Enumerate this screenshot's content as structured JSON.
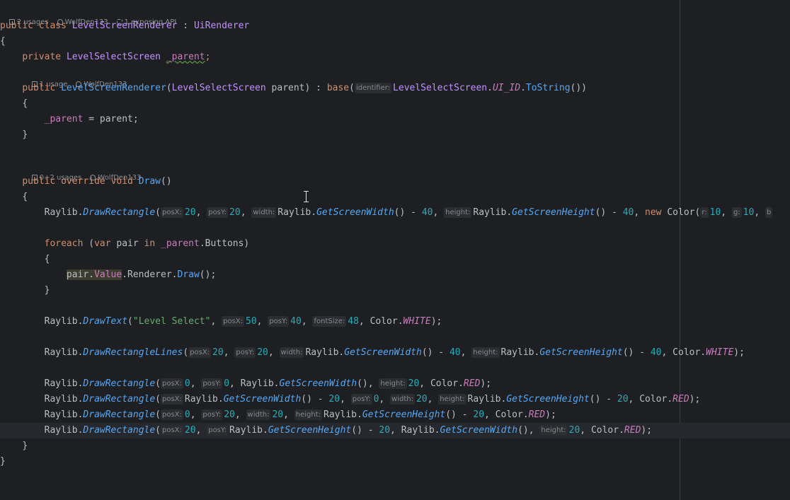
{
  "class_meta": {
    "usages": "2 usages",
    "author": "WolfDen133",
    "api": "1 exposing API"
  },
  "ctor_meta": {
    "usages": "1 usage",
    "author": "WolfDen133"
  },
  "draw_meta": {
    "usages": "0+2 usages",
    "author": "WolfDen133"
  },
  "code": {
    "l1": {
      "kw1": "public",
      "kw2": "class",
      "name": "LevelScreenRenderer",
      "sep": " : ",
      "base": "UiRenderer"
    },
    "l2": "{",
    "l3": {
      "kw": "private",
      "type": "LevelSelectScreen",
      "field": "_parent",
      "semi": ";"
    },
    "l4": {
      "kw": "public",
      "name": "LevelScreenRenderer",
      "open": "(",
      "ptype": "LevelSelectScreen",
      "pname": " parent",
      "close": ") : ",
      "base": "base",
      "bopen": "(",
      "hint": "identifier:",
      "cls": "LevelSelectScreen",
      "dot": ".",
      "const": "UI_ID",
      "dot2": ".",
      "mtd": "ToString",
      "end": "())"
    },
    "l5": "{",
    "l6": {
      "field": "_parent",
      "rest": " = parent;"
    },
    "l7": "}",
    "l8": {
      "kw1": "public",
      "kw2": "override",
      "kw3": "void",
      "name": "Draw",
      "rest": "()"
    },
    "l9": "{",
    "l10": {
      "a": "Raylib.",
      "m": "DrawRectangle",
      "p": "(",
      "h1": "posX:",
      "n1": "20",
      "c1": ", ",
      "h2": "posY:",
      "n2": "20",
      "c2": ", ",
      "h3": "width:",
      "t3": "Raylib.",
      "m3": "GetScreenWidth",
      "r3": "() - ",
      "n3": "40",
      "c3": ", ",
      "h4": "height:",
      "t4": "Raylib.",
      "m4": "GetScreenHeight",
      "r4": "() - ",
      "n4": "40",
      "c4": ", ",
      "kw": "new",
      "t5": " Color(",
      "h5": "r:",
      "n5": "10",
      "c5": ", ",
      "h6": "g:",
      "n6": "10",
      "c6": ", ",
      "h7": "b"
    },
    "l11": {
      "kw1": "foreach",
      "sp": " (",
      "kw2": "var",
      "v": " pair ",
      "kw3": "in",
      "f": " _parent",
      "rest": ".Buttons)"
    },
    "l12": "{",
    "l13": {
      "a": "pair.",
      "b": "Value",
      "c": ".Renderer.",
      "m": "Draw",
      "e": "();"
    },
    "l14": "}",
    "l15": {
      "a": "Raylib.",
      "m": "DrawText",
      "p": "(",
      "s": "\"Level Select\"",
      "c0": ", ",
      "h1": "posX:",
      "n1": "50",
      "c1": ", ",
      "h2": "posY:",
      "n2": "40",
      "c2": ", ",
      "h3": "fontSize:",
      "n3": "48",
      "c3": ", Color.",
      "k": "WHITE",
      "e": ");"
    },
    "l16": {
      "a": "Raylib.",
      "m": "DrawRectangleLines",
      "p": "(",
      "h1": "posX:",
      "n1": "20",
      "c1": ", ",
      "h2": "posY:",
      "n2": "20",
      "c2": ", ",
      "h3": "width:",
      "t3": "Raylib.",
      "m3": "GetScreenWidth",
      "r3": "() - ",
      "n3": "40",
      "c3": ", ",
      "h4": "height:",
      "t4": "Raylib.",
      "m4": "GetScreenHeight",
      "r4": "() - ",
      "n4": "40",
      "c4": ", Color.",
      "k": "WHITE",
      "e": ");"
    },
    "l17": {
      "a": "Raylib.",
      "m": "DrawRectangle",
      "p": "(",
      "h1": "posX:",
      "n1": "0",
      "c1": ", ",
      "h2": "posY:",
      "n2": "0",
      "c2": ", Raylib.",
      "m3": "GetScreenWidth",
      "r3": "(), ",
      "h4": "height:",
      "n4": "20",
      "c4": ", Color.",
      "k": "RED",
      "e": ");"
    },
    "l18": {
      "a": "Raylib.",
      "m": "DrawRectangle",
      "p": "(",
      "h1": "posX:",
      "t1": "Raylib.",
      "m1": "GetScreenWidth",
      "r1": "() - ",
      "n1": "20",
      "c1": ", ",
      "h2": "posY:",
      "n2": "0",
      "c2": ", ",
      "h3": "width:",
      "n3": "20",
      "c3": ", ",
      "h4": "height:",
      "t4": "Raylib.",
      "m4": "GetScreenHeight",
      "r4": "() - ",
      "n4": "20",
      "c4": ", Color.",
      "k": "RED",
      "e": ");"
    },
    "l19": {
      "a": "Raylib.",
      "m": "DrawRectangle",
      "p": "(",
      "h1": "posX:",
      "n1": "0",
      "c1": ", ",
      "h2": "posY:",
      "n2": "20",
      "c2": ", ",
      "h3": "width:",
      "n3": "20",
      "c3": ", ",
      "h4": "height:",
      "t4": "Raylib.",
      "m4": "GetScreenHeight",
      "r4": "() - ",
      "n4": "20",
      "c4": ", Color.",
      "k": "RED",
      "e": ");"
    },
    "l20": {
      "a": "Raylib.",
      "m": "DrawRectangle",
      "p": "(",
      "h1": "posX:",
      "n1": "20",
      "c1": ", ",
      "h2": "posY:",
      "t2": "Raylib.",
      "m2": "GetScreenHeight",
      "r2": "() - ",
      "n2": "20",
      "c2": ", Raylib.",
      "m3": "GetScreenWidth",
      "r3": "(), ",
      "h4": "height:",
      "n4": "20",
      "c4": ", Color.",
      "k": "RED",
      "e": ");"
    },
    "l21": "}",
    "l22": "}"
  },
  "colors": {
    "background": "#1e1f22",
    "keyword": "#cf8e6d",
    "method": "#56a8f5",
    "number": "#2aacb8",
    "string": "#6aab73",
    "field": "#c77dbb"
  },
  "icons": {
    "usages": "usages-icon",
    "author": "user-icon",
    "api": "api-icon",
    "cursor": "text-cursor-icon"
  }
}
